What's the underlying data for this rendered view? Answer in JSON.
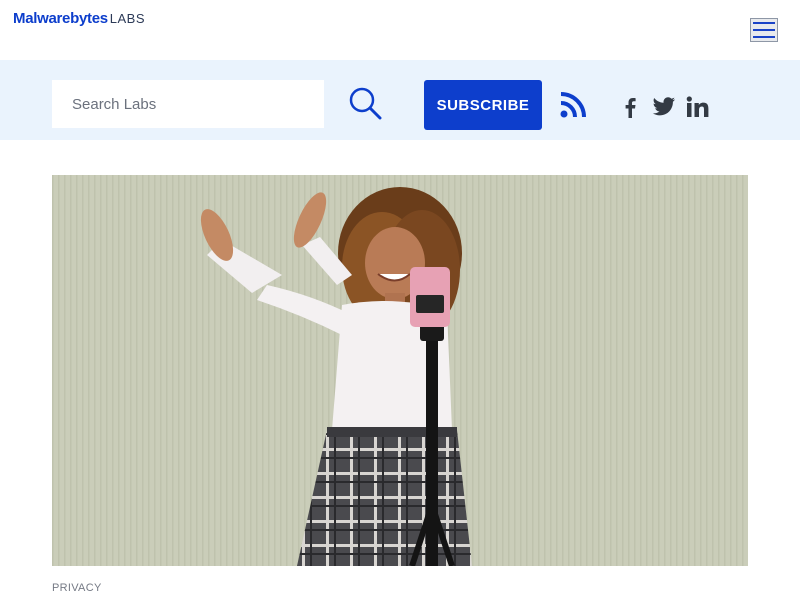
{
  "header": {
    "brand": "Malwarebytes",
    "brand_suffix": "LABS",
    "menu_icon": "hamburger-menu-icon"
  },
  "toolbar": {
    "search_placeholder": "Search Labs",
    "search_icon": "search-icon",
    "subscribe_label": "SUBSCRIBE",
    "social_icons": [
      "rss-icon",
      "facebook-icon",
      "twitter-icon",
      "linkedin-icon"
    ]
  },
  "article": {
    "category": "PRIVACY"
  },
  "colors": {
    "brand_blue": "#0d3ecc",
    "toolbar_bg": "#eaf3fd",
    "hero_bg": "#c9ccb8"
  }
}
